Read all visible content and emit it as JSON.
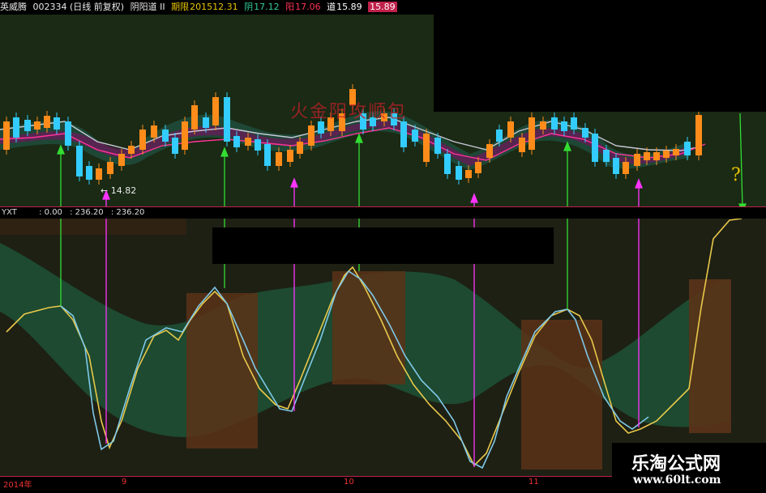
{
  "header": {
    "app": "英威腾",
    "code": "002334",
    "period": "(日线 前复权)",
    "indicator_name": "阴阳道 II",
    "date_label": "期限",
    "date_value": "201512.31",
    "yin_label": "阴",
    "yin_value": "17.12",
    "yang_label": "阳",
    "yang_value": "17.06",
    "dao_label": "道",
    "dao_value": "15.89",
    "last_value": "15.89"
  },
  "price_panel": {
    "low_marker": "14.82",
    "question_mark": "?",
    "overlay_text": "火金阳攻顺包"
  },
  "indicator": {
    "name": "YXT",
    "v1": "0.00",
    "v2": "236.20",
    "v3": "236.20"
  },
  "axis": {
    "year": "2014年",
    "m9": "9",
    "m10": "10",
    "m11": "11"
  },
  "watermark": {
    "title": "乐淘公式网",
    "url": "www.60lt.com"
  },
  "colors": {
    "up": "#ff8c1a",
    "down": "#33ccff",
    "green_arrow": "#33dd33",
    "magenta_arrow": "#ff33ff",
    "yellow_line": "#e8c84a",
    "cyan_line": "#7fc8e8"
  }
}
